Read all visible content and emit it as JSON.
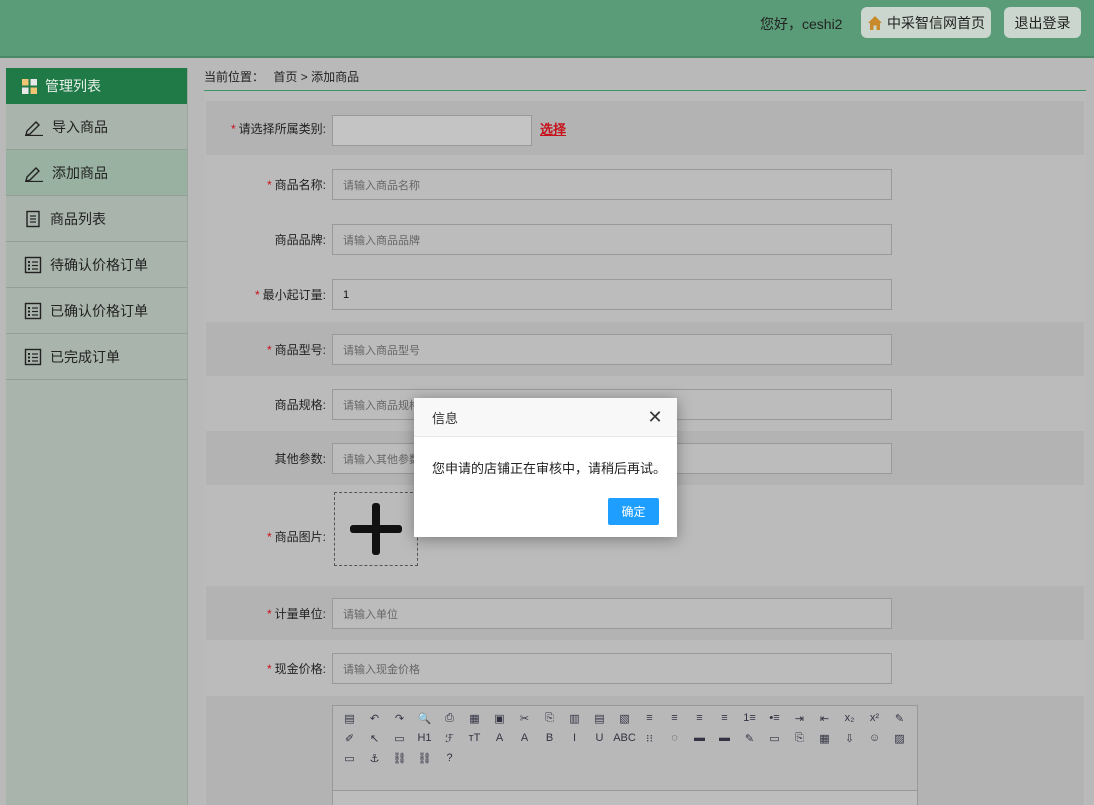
{
  "header": {
    "greeting": "您好，ceshi2",
    "home_label": "中采智信网首页",
    "logout_label": "退出登录"
  },
  "sidebar": {
    "title": "管理列表",
    "items": [
      {
        "label": "导入商品",
        "icon": "edit-icon"
      },
      {
        "label": "添加商品",
        "icon": "edit-icon",
        "active": true
      },
      {
        "label": "商品列表",
        "icon": "document-icon"
      },
      {
        "label": "待确认价格订单",
        "icon": "list-icon"
      },
      {
        "label": "已确认价格订单",
        "icon": "list-icon"
      },
      {
        "label": "已完成订单",
        "icon": "list-icon"
      }
    ]
  },
  "breadcrumb": {
    "prefix": "当前位置：",
    "home": "首页",
    "sep": ">",
    "current": "添加商品"
  },
  "form": {
    "category_label": "请选择所属类别:",
    "category_value": "",
    "category_select": "选择",
    "name_label": "商品名称:",
    "name_placeholder": "请输入商品名称",
    "brand_label": "商品品牌:",
    "brand_placeholder": "请输入商品品牌",
    "moq_label": "最小起订量:",
    "moq_value": "1",
    "model_label": "商品型号:",
    "model_placeholder": "请输入商品型号",
    "spec_label": "商品规格:",
    "spec_placeholder": "请输入商品规格",
    "other_label": "其他参数:",
    "other_placeholder": "请输入其他参数",
    "image_label": "商品图片:",
    "unit_label": "计量单位:",
    "unit_placeholder": "请输入单位",
    "price_label": "现金价格:",
    "price_placeholder": "请输入现金价格"
  },
  "editor": {
    "toolbar": [
      "▤",
      "↶",
      "↷",
      "🔍",
      "⎙",
      "▦",
      "▣",
      "✂",
      "⎘",
      "▥",
      "▤",
      "▧",
      "≡",
      "≡",
      "≡",
      "≡",
      "1≡",
      "•≡",
      "⇥",
      "⇤",
      "x₂",
      "x²",
      "✎",
      "✐",
      "↖",
      "▭",
      "H1",
      "ℱ",
      "тT",
      "A",
      "A",
      "B",
      "I",
      "U",
      "ABC",
      "⁝⁝",
      "◌",
      "▬",
      "▬",
      "✎",
      "▭",
      "⎘",
      "▦",
      "⇩",
      "☺",
      "▨",
      "▭",
      "⚓",
      "⛓",
      "⛓",
      "?"
    ]
  },
  "modal": {
    "title": "信息",
    "message": "您申请的店铺正在审核中，请稍后再试。",
    "ok_label": "确定"
  },
  "colors": {
    "header": "#5a9c78",
    "sidebar_head": "#1f7a47",
    "required": "#c8101a",
    "ok_button": "#1e9fff"
  }
}
